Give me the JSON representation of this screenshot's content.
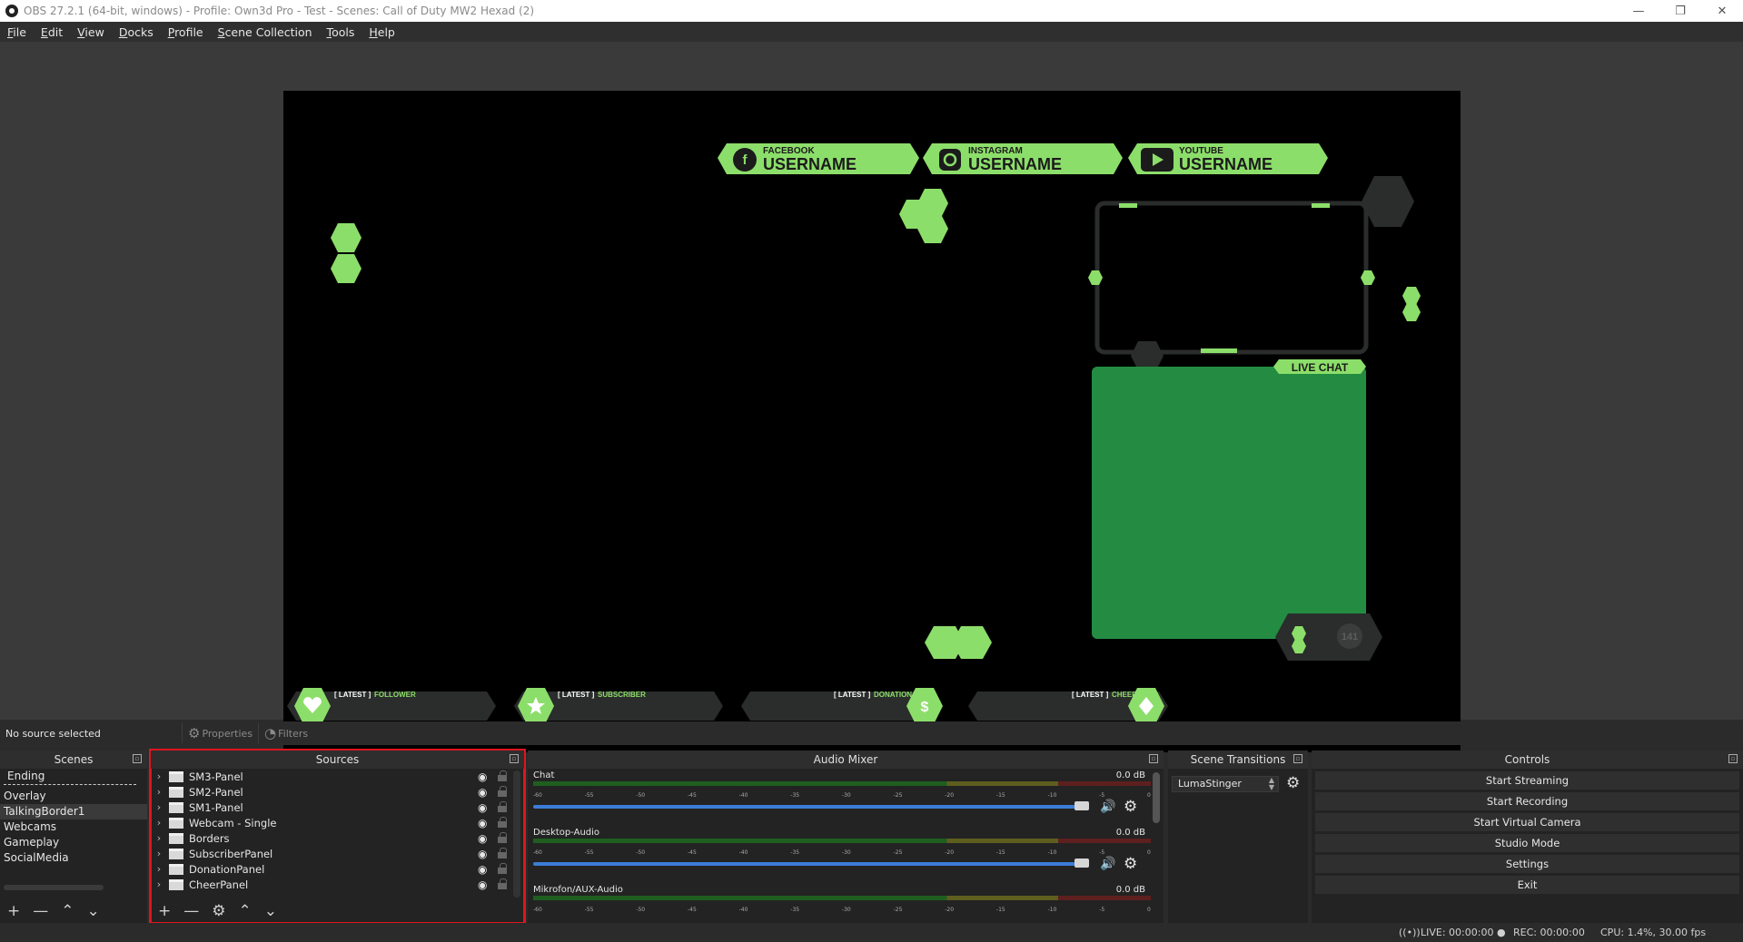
{
  "window": {
    "title": "OBS 27.2.1 (64-bit, windows) - Profile: Own3d Pro - Test - Scenes: Call of Duty MW2 Hexad (2)",
    "minimize_glyph": "—",
    "restore_glyph": "❐",
    "close_glyph": "✕"
  },
  "menu": [
    "File",
    "Edit",
    "View",
    "Docks",
    "Profile",
    "Scene Collection",
    "Tools",
    "Help"
  ],
  "preview": {
    "social": [
      {
        "network": "FACEBOOK",
        "handle": "USERNAME",
        "icon": "facebook-icon"
      },
      {
        "network": "INSTAGRAM",
        "handle": "USERNAME",
        "icon": "instagram-icon"
      },
      {
        "network": "YOUTUBE",
        "handle": "USERNAME",
        "icon": "youtube-icon"
      }
    ],
    "live_chat_label": "LIVE CHAT",
    "viewer_count": "141",
    "latest": [
      {
        "prefix": "[ LATEST ]",
        "type": "FOLLOWER",
        "icon": "heart-icon"
      },
      {
        "prefix": "[ LATEST ]",
        "type": "SUBSCRIBER",
        "icon": "star-icon"
      },
      {
        "prefix": "[ LATEST ]",
        "type": "DONATION",
        "icon": "dollar-icon"
      },
      {
        "prefix": "[ LATEST ]",
        "type": "CHEER",
        "icon": "diamond-icon"
      }
    ],
    "colors": {
      "accent": "#8cde6a",
      "panel": "#238c42",
      "dark": "#2a2d2b"
    }
  },
  "context": {
    "status": "No source selected",
    "properties_label": "Properties",
    "filters_label": "Filters"
  },
  "scenes": {
    "header": "Scenes",
    "items": [
      "Ending",
      "Overlay",
      "TalkingBorder1",
      "Webcams",
      "Gameplay",
      "SocialMedia"
    ],
    "selected": "TalkingBorder1"
  },
  "sources": {
    "header": "Sources",
    "items": [
      "SM3-Panel",
      "SM2-Panel",
      "SM1-Panel",
      "Webcam - Single",
      "Borders",
      "SubscriberPanel",
      "DonationPanel",
      "CheerPanel"
    ]
  },
  "mixer": {
    "header": "Audio Mixer",
    "ticks": [
      "-60",
      "-55",
      "-50",
      "-45",
      "-40",
      "-35",
      "-30",
      "-25",
      "-20",
      "-15",
      "-10",
      "-5",
      "0"
    ],
    "channels": [
      {
        "name": "Chat",
        "db": "0.0 dB",
        "volume": 1.0
      },
      {
        "name": "Desktop-Audio",
        "db": "0.0 dB",
        "volume": 1.0
      },
      {
        "name": "Mikrofon/AUX-Audio",
        "db": "0.0 dB",
        "volume": 1.0
      }
    ]
  },
  "transitions": {
    "header": "Scene Transitions",
    "selected": "LumaStinger"
  },
  "controls": {
    "header": "Controls",
    "buttons": [
      "Start Streaming",
      "Start Recording",
      "Start Virtual Camera",
      "Studio Mode",
      "Settings",
      "Exit"
    ]
  },
  "status": {
    "live": "LIVE: 00:00:00",
    "rec": "REC: 00:00:00",
    "cpu": "CPU: 1.4%, 30.00 fps"
  }
}
